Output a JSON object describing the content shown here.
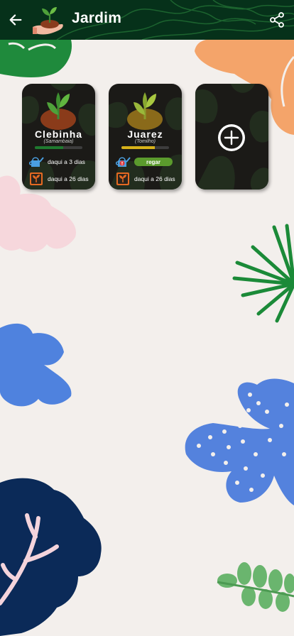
{
  "header": {
    "title": "Jardim",
    "back_icon": "arrow-left-icon",
    "share_icon": "share-icon",
    "logo_icon": "hand-holding-sprout-icon",
    "background_color": "#06311a"
  },
  "plants": [
    {
      "name": "Clebinha",
      "species": "(Samambaia)",
      "health_percent": 60,
      "health_color": "#1f7a2f",
      "water_text": "daqui a 3 dias",
      "water_alert": false,
      "fertilize_text": "daqui a 26 dias"
    },
    {
      "name": "Juarez",
      "species": "(Tomilho)",
      "health_percent": 70,
      "health_color": "#d7b21a",
      "water_action": "regar",
      "water_alert": true,
      "fertilize_text": "daqui a 26 dias"
    }
  ],
  "add_card": {
    "icon": "plus-circle-icon"
  },
  "icons": {
    "water": "watering-can-icon",
    "fertilize": "fertilizer-bag-icon"
  },
  "colors": {
    "background": "#f3efec",
    "card": "#1b1a17",
    "accent_green": "#5b9b2d"
  }
}
